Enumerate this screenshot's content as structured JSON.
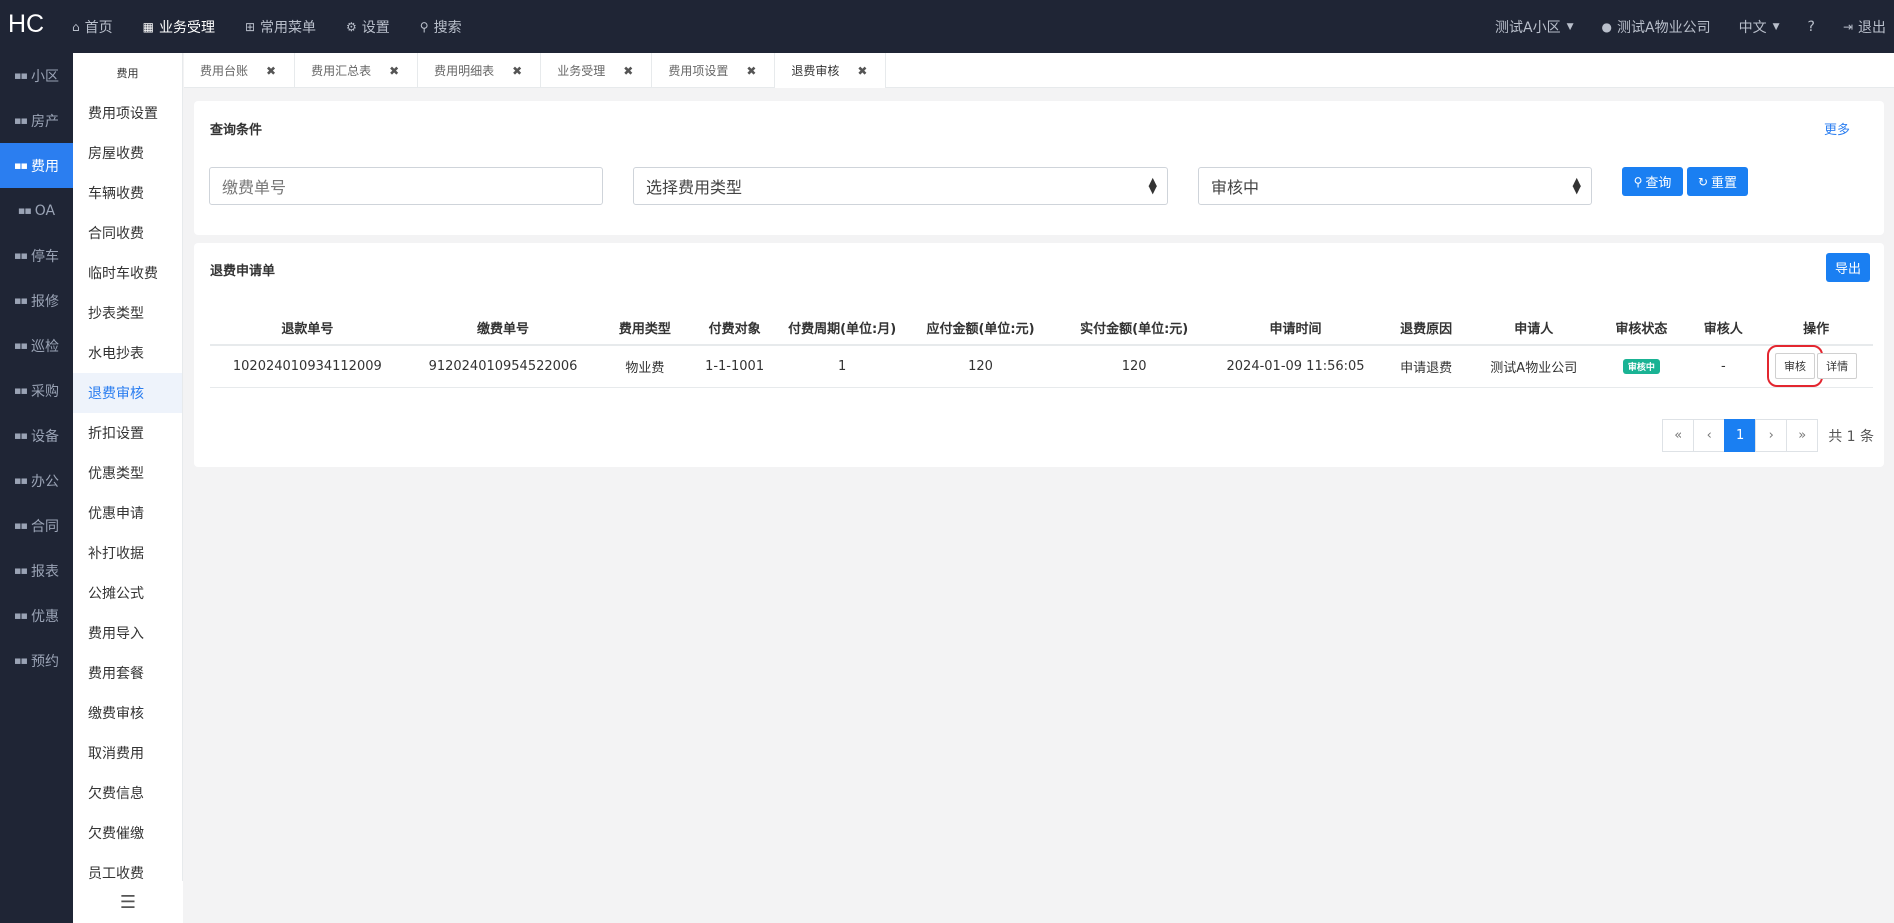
{
  "brand": "HC",
  "topnav": [
    {
      "icon": "home-icon",
      "glyph": "⌂",
      "label": "首页"
    },
    {
      "icon": "calculator-icon",
      "glyph": "▦",
      "label": "业务受理"
    },
    {
      "icon": "sitemap-icon",
      "glyph": "⊞",
      "label": "常用菜单"
    },
    {
      "icon": "gear-icon",
      "glyph": "⚙",
      "label": "设置"
    },
    {
      "icon": "search-icon",
      "glyph": "⚲",
      "label": "搜索"
    }
  ],
  "topright": {
    "community": "测试A小区",
    "company": "测试A物业公司",
    "language": "中文",
    "help_glyph": "?",
    "logout": "退出"
  },
  "leftnav": [
    "小区",
    "房产",
    "费用",
    "OA",
    "停车",
    "报修",
    "巡检",
    "采购",
    "设备",
    "办公",
    "合同",
    "报表",
    "优惠",
    "预约"
  ],
  "leftnav_active": "费用",
  "submenu": {
    "title": "费用",
    "items": [
      "费用项设置",
      "房屋收费",
      "车辆收费",
      "合同收费",
      "临时车收费",
      "抄表类型",
      "水电抄表",
      "退费审核",
      "折扣设置",
      "优惠类型",
      "优惠申请",
      "补打收据",
      "公摊公式",
      "费用导入",
      "费用套餐",
      "缴费审核",
      "取消费用",
      "欠费信息",
      "欠费催缴",
      "员工收费"
    ],
    "active": "退费审核",
    "collapse_glyph": "☰"
  },
  "tabs": [
    "费用台账",
    "费用汇总表",
    "费用明细表",
    "业务受理",
    "费用项设置",
    "退费审核"
  ],
  "tab_close": "✖",
  "query": {
    "title": "查询条件",
    "more": "更多",
    "payment_no_placeholder": "缴费单号",
    "fee_type": "选择费用类型",
    "status": "审核中",
    "search_btn": "查询",
    "reset_btn": "重置"
  },
  "list": {
    "title": "退费申请单",
    "export_btn": "导出",
    "columns": [
      "退款单号",
      "缴费单号",
      "费用类型",
      "付费对象",
      "付费周期(单位:月)",
      "应付金额(单位:元)",
      "实付金额(单位:元)",
      "申请时间",
      "退费原因",
      "申请人",
      "审核状态",
      "审核人",
      "操作"
    ],
    "rows": [
      {
        "refund_no": "102024010934112009",
        "payment_no": "912024010954522006",
        "fee_type": "物业费",
        "payer": "1-1-1001",
        "cycle": "1",
        "due": "120",
        "paid": "120",
        "apply_time": "2024-01-09 11:56:05",
        "reason": "申请退费",
        "applicant": "测试A物业公司",
        "status": "审核中",
        "auditor": "-",
        "audit_btn": "审核",
        "detail_btn": "详情"
      }
    ]
  },
  "pagination": {
    "first": "«",
    "prev": "‹",
    "current": "1",
    "next": "›",
    "last": "»",
    "total": "共 1 条"
  },
  "colors": {
    "sidebar_bg": "#1f2535",
    "accent": "#1a7ff2",
    "badge_green": "#1ab394",
    "highlight_red": "#e3262f"
  }
}
